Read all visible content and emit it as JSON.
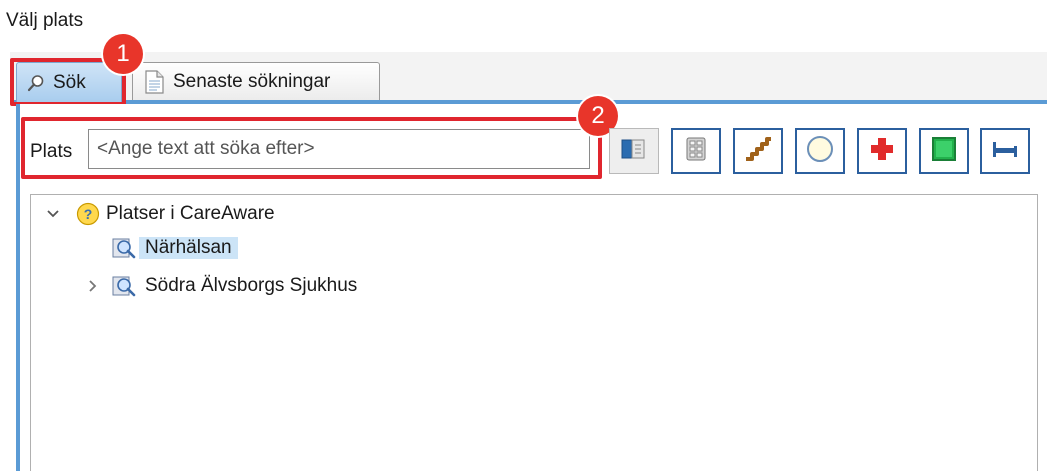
{
  "window": {
    "title": "Välj plats"
  },
  "tabs": [
    {
      "label": "Sök",
      "icon": "search-icon",
      "active": true
    },
    {
      "label": "Senaste sökningar",
      "icon": "document-icon",
      "active": false
    }
  ],
  "annotations": {
    "badge_1": "1",
    "badge_2": "2",
    "color": "#e8352a"
  },
  "search": {
    "label": "Plats",
    "placeholder": "<Ange text att söka efter>"
  },
  "toolbar": [
    {
      "icon": "map-book-icon"
    },
    {
      "icon": "building-icon"
    },
    {
      "icon": "stairs-icon"
    },
    {
      "icon": "circle-icon"
    },
    {
      "icon": "red-cross-icon"
    },
    {
      "icon": "green-square-icon"
    },
    {
      "icon": "bed-icon"
    }
  ],
  "tree": {
    "root": {
      "label": "Platser i CareAware",
      "icon": "help-icon",
      "expanded": true
    },
    "children": [
      {
        "label": "Närhälsan",
        "icon": "location-search-icon",
        "selected": true,
        "expandable": false
      },
      {
        "label": "Södra Älvsborgs Sjukhus",
        "icon": "location-search-icon",
        "selected": false,
        "expandable": true
      }
    ]
  },
  "colors": {
    "accent": "#5b9bd5",
    "highlight": "#e0262e",
    "selection": "#cce4f7"
  }
}
